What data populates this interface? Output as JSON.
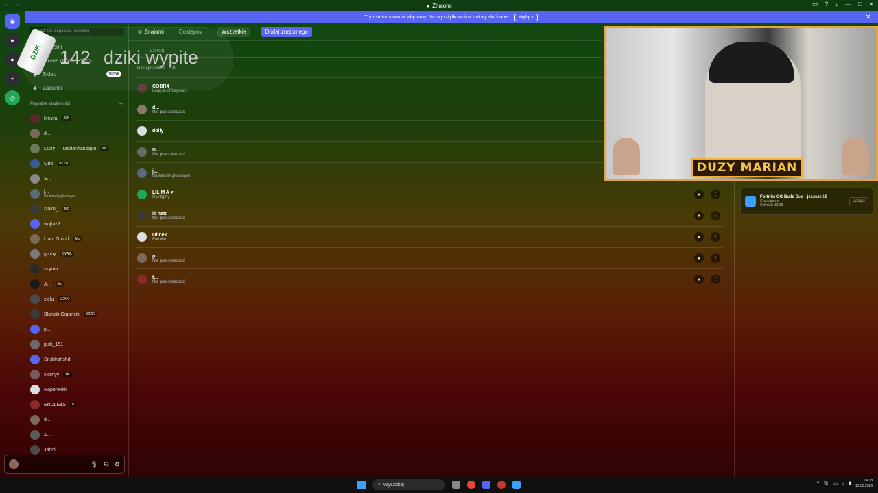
{
  "window": {
    "title": "Znajomi"
  },
  "banner": {
    "text": "Tryb streamowania włączony. Nazwy użytkownika zostały skrócone.",
    "button": "Wyłącz"
  },
  "sidebar": {
    "search_placeholder": "Znajdź lub rozpocznij rozmowę",
    "nav": [
      {
        "label": "Znajomi",
        "icon": "friends-icon"
      },
      {
        "label": "Strona główna Nitro",
        "icon": "nitro-icon"
      },
      {
        "label": "Sklep",
        "icon": "shop-icon",
        "badge": "NOWE"
      },
      {
        "label": "Zadania",
        "icon": "quests-icon"
      }
    ],
    "dm_header": "Prywatne wiadomości",
    "dms": [
      {
        "name": "hmvra",
        "tag": "JZK",
        "color": "#5a2a2a"
      },
      {
        "name": "d...",
        "tag": "",
        "color": "#7a6a5a"
      },
      {
        "name": "Duzy___Marian/fanpage",
        "tag": "Mc",
        "color": "#6a7a5a"
      },
      {
        "name": "Ottо",
        "tag": "BZZR",
        "color": "#3a5a9a"
      },
      {
        "name": "S...",
        "tag": "",
        "color": "#8a8a8a"
      },
      {
        "name": "j...",
        "tag": "",
        "sub": "Na kanale głosowym",
        "color": "#5a6a7a"
      },
      {
        "name": "Izaku_",
        "tag": "Mc",
        "color": "#3a3a3a"
      },
      {
        "name": "wojtaz2",
        "tag": "",
        "color": "#5865f2"
      },
      {
        "name": "Liam Grund",
        "tag": "Mc",
        "color": "#7a6a5a"
      },
      {
        "name": "gruby",
        "tag": "CWEL",
        "color": "#7a7a7a"
      },
      {
        "name": "szymix",
        "tag": "",
        "color": "#2a2a2a"
      },
      {
        "name": "A...",
        "tag": "Mc",
        "color": "#1a1a1a"
      },
      {
        "name": "zielu",
        "tag": "LEAK",
        "color": "#4a4a4a"
      },
      {
        "name": "Blancik Gigancik",
        "tag": "BZZR",
        "color": "#3a3a3a"
      },
      {
        "name": "p...",
        "tag": "",
        "color": "#5865f2"
      },
      {
        "name": "jack_151",
        "tag": "",
        "color": "#6a6a6a"
      },
      {
        "name": "Snsbhshshd",
        "tag": "",
        "color": "#5865f2"
      },
      {
        "name": "ciornyy",
        "tag": "xtc",
        "color": "#7a5a5a"
      },
      {
        "name": "Haperekkk",
        "tag": "",
        "color": "#dbdee1"
      },
      {
        "name": "ENDLE$S",
        "tag": "0",
        "color": "#8a2a2a"
      },
      {
        "name": "d...",
        "tag": "",
        "color": "#7a6a5a"
      },
      {
        "name": "Z...",
        "tag": "",
        "color": "#5a5a5a"
      },
      {
        "name": "Jabol",
        "tag": "",
        "color": "#4a4a4a"
      }
    ]
  },
  "header": {
    "title": "Znajomi",
    "tabs": [
      {
        "label": "Dostępny"
      },
      {
        "label": "Wszystkie"
      }
    ],
    "add_button": "Dodaj znajomego"
  },
  "friends": {
    "search_placeholder": "Szukaj",
    "online_count": "Dostępni online — 10",
    "list": [
      {
        "name": "COBR4",
        "status": "League of Legends",
        "color": "#5a3a3a",
        "actions": false
      },
      {
        "name": "d...",
        "status": "Nie przeszkadzać",
        "color": "#8a7a6a",
        "actions": false
      },
      {
        "name": "dolly",
        "status": "",
        "color": "#dbdee1",
        "actions": false
      },
      {
        "name": "D...",
        "status": "Nie przeszkadzać",
        "color": "#6a6a6a",
        "actions": false
      },
      {
        "name": "j...",
        "status": "Na kanale głosowym",
        "color": "#5a6a7a",
        "actions": false
      },
      {
        "name": "LIL M A ♥",
        "status": "Dostępny",
        "color": "#23a55a",
        "actions": true
      },
      {
        "name": "lil nett",
        "status": "Nie przeszkadzać",
        "color": "#3a3a3a",
        "actions": true
      },
      {
        "name": "Olinek",
        "status": "Fortnite",
        "color": "#dbdee1",
        "actions": true
      },
      {
        "name": "p...",
        "status": "Nie przeszkadzać",
        "color": "#7a6a5a",
        "actions": true
      },
      {
        "name": "t...",
        "status": "Nie przeszkadzać",
        "color": "#8a2a2a",
        "actions": true
      }
    ]
  },
  "activity": {
    "title": "Fortnite OG Build Duo - jeszcze 10",
    "sub1": "Gra w parze",
    "sub2": "Upłynęło 13:08",
    "join": "Dołącz"
  },
  "overlay": {
    "count": "142",
    "text": "dziki wypite",
    "can_label": "DZIK"
  },
  "webcam": {
    "nameplate": "DUZY MARIAN"
  },
  "taskbar": {
    "search": "Wyszukaj",
    "time": "14:38",
    "date": "13.03.2026"
  }
}
